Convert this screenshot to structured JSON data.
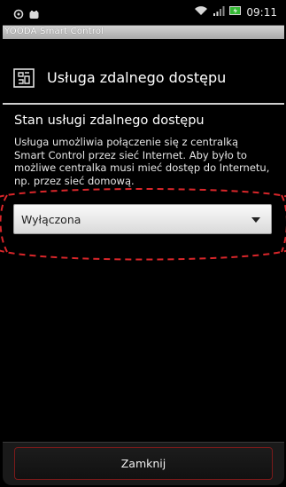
{
  "status_bar": {
    "time": "09:11",
    "icons": [
      "usb-icon",
      "notification-icon",
      "wifi-icon",
      "signal-icon",
      "battery-icon"
    ]
  },
  "app": {
    "title": "YOODA Smart Control"
  },
  "dialog": {
    "icon": "building-icon",
    "title": "Usługa zdalnego dostępu",
    "section_title": "Stan usługi zdalnego dostępu",
    "description": "Usługa umożliwia połączenie się z centralką Smart Control przez sieć Internet. Aby było to możliwe centralka musi mieć dostęp do Internetu, np. przez sieć domową.",
    "select": {
      "value": "Wyłączona"
    },
    "close_label": "Zamknij"
  },
  "colors": {
    "background": "#000000",
    "highlight": "#d9262a",
    "close_border": "#7a1a1a",
    "title_bar": "#bdbdbd"
  }
}
